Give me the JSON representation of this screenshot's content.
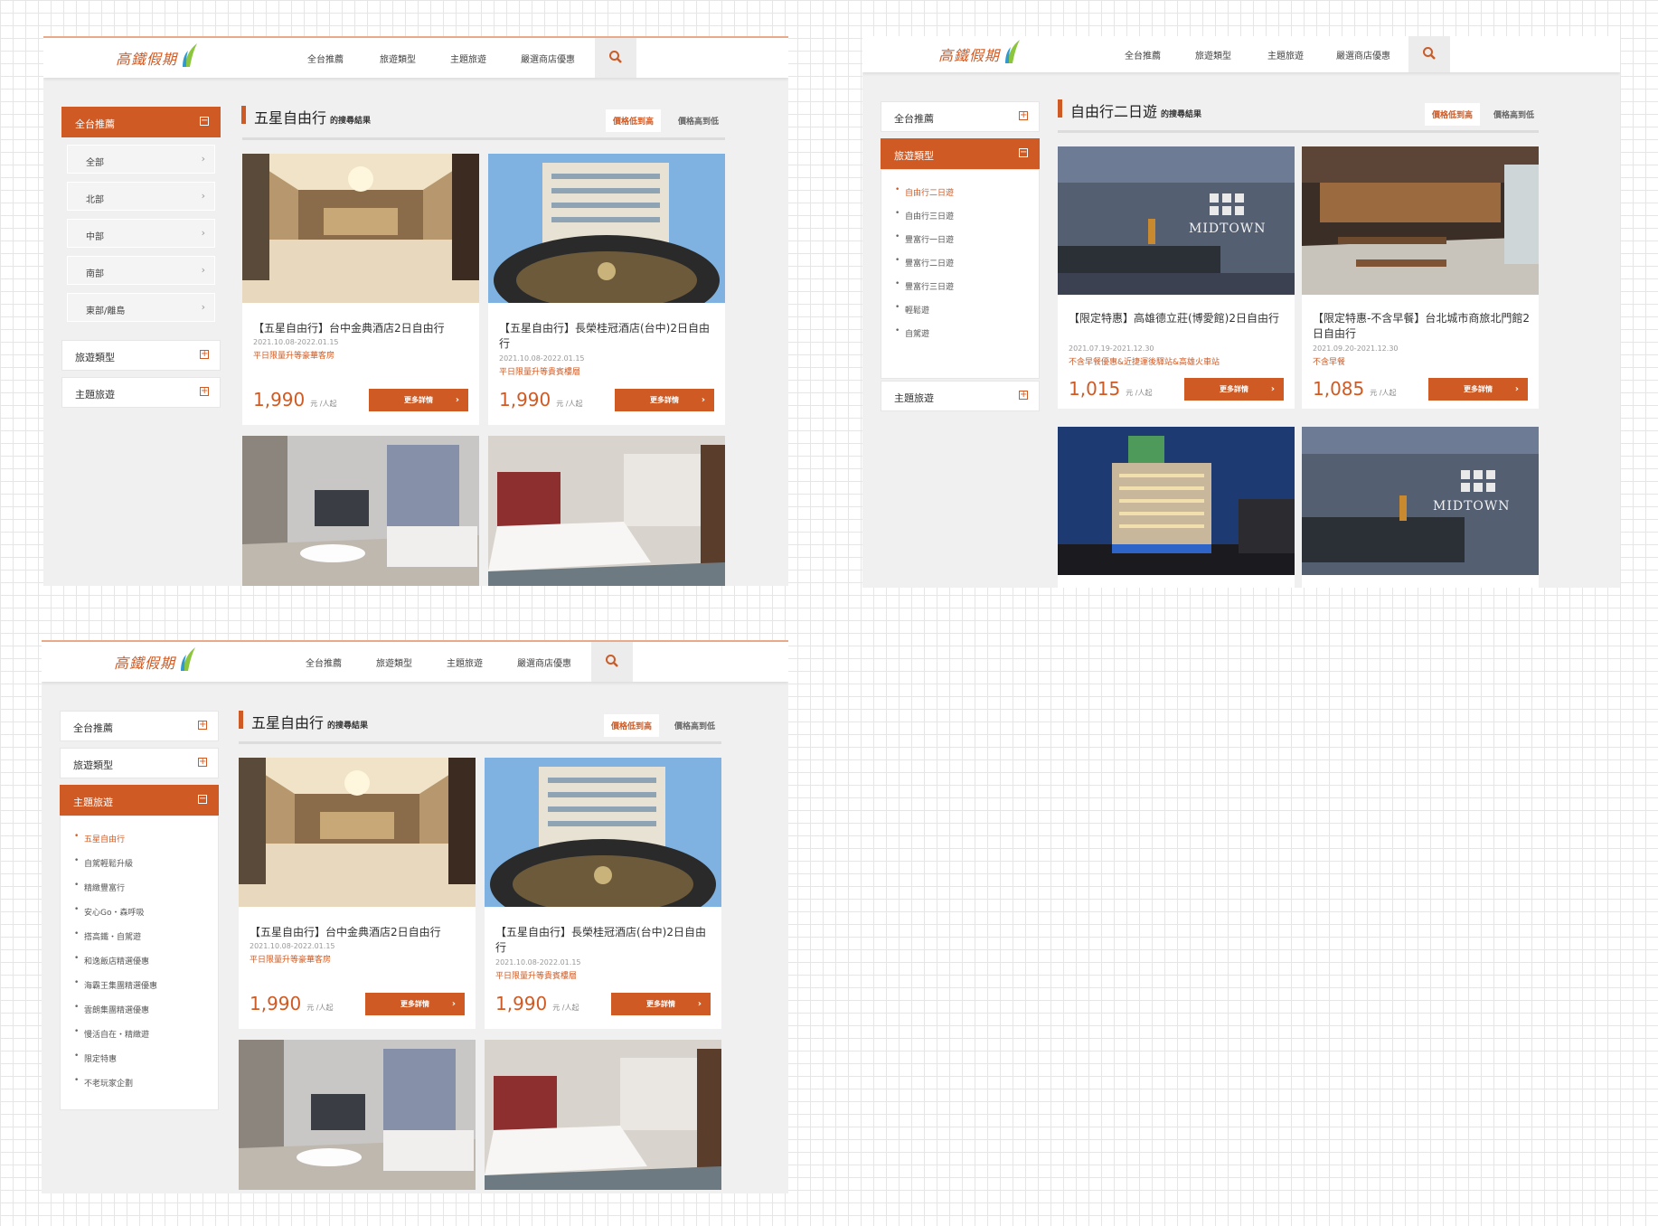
{
  "nav": {
    "logo": "高鐵假期",
    "links": [
      "全台推薦",
      "旅遊類型",
      "主題旅遊",
      "嚴選商店優惠"
    ],
    "search_icon": "search-icon"
  },
  "colors": {
    "accent": "#d05a23",
    "background": "#f0f0f0"
  },
  "sort": {
    "low_high": "價格低到高",
    "high_low": "價格高到低"
  },
  "cards": {
    "detail_label": "更多詳情",
    "price_unit": "元 /人起",
    "c1": {
      "title": "【五星自由行】台中金典酒店2日自由行",
      "date": "2021.10.08-2022.01.15",
      "note": "平日限量升等豪華客房",
      "price": "1,990"
    },
    "c2": {
      "title": "【五星自由行】長榮桂冠酒店(台中)2日自由行",
      "date": "2021.10.08-2022.01.15",
      "note": "平日限量升等貴賓樓層",
      "price": "1,990"
    },
    "c3": {
      "title": "【限定特惠】高雄德立莊(博愛館)2日自由行",
      "date": "2021.07.19-2021.12.30",
      "note": "不含早餐優惠&近捷運後驛站&高雄火車站",
      "price": "1,015"
    },
    "c4": {
      "title": "【限定特惠-不含早餐】台北城市商旅北門館2日自由行",
      "date": "2021.09.20-2021.12.30",
      "note": "不含早餐",
      "price": "1,085"
    }
  },
  "panel1": {
    "sidebar": {
      "recommend": "全台推薦",
      "regions": [
        "全部",
        "北部",
        "中部",
        "南部",
        "東部/離島"
      ],
      "travel_type": "旅遊類型",
      "theme": "主題旅遊"
    },
    "results_title": "五星自由行",
    "results_suffix": "的搜尋結果"
  },
  "panel2": {
    "sidebar": {
      "recommend": "全台推薦",
      "travel_type": "旅遊類型",
      "types": [
        "自由行二日遊",
        "自由行三日遊",
        "豐富行一日遊",
        "豐富行二日遊",
        "豐富行三日遊",
        "輕鬆遊",
        "自駕遊"
      ],
      "theme": "主題旅遊"
    },
    "results_title": "自由行二日遊",
    "results_suffix": "的搜尋結果"
  },
  "panel3": {
    "sidebar": {
      "recommend": "全台推薦",
      "travel_type": "旅遊類型",
      "theme": "主題旅遊",
      "themes": [
        "五星自由行",
        "自駕輕鬆升級",
        "精緻豐富行",
        "安心Go・森呼吸",
        "搭高鐵・自駕遊",
        "和逸飯店精選優惠",
        "海霸王集團精選優惠",
        "雲朗集團精選優惠",
        "慢活自在・精緻遊",
        "限定特惠",
        "不老玩家企劃"
      ]
    },
    "results_title": "五星自由行",
    "results_suffix": "的搜尋結果"
  }
}
